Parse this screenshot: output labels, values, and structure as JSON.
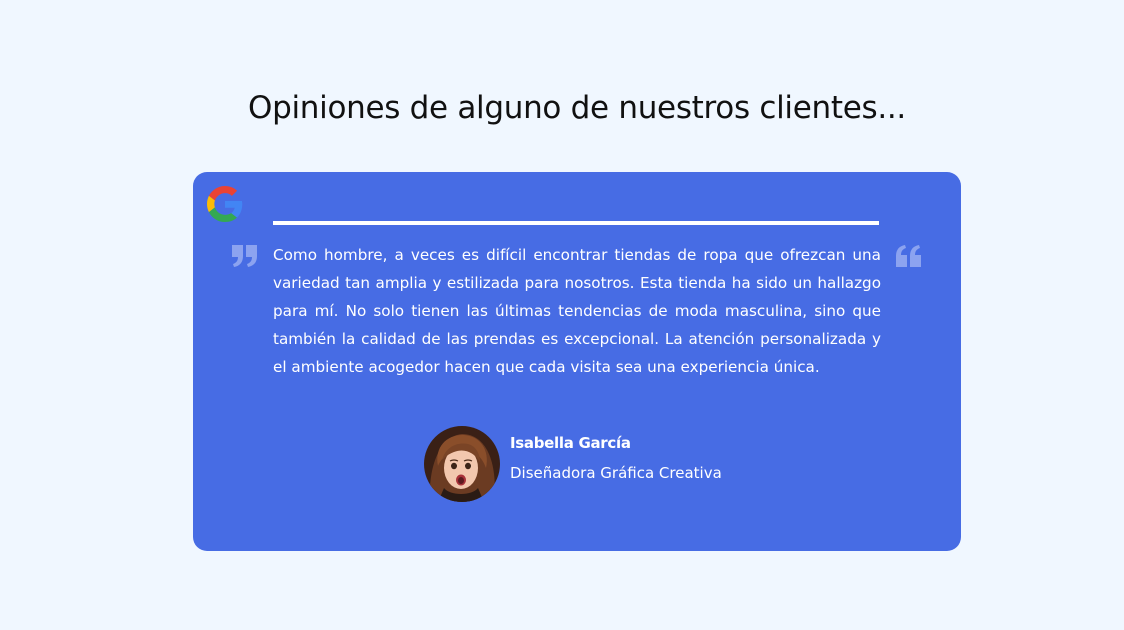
{
  "section": {
    "title": "Opiniones de alguno de nuestros clientes..."
  },
  "testimonial": {
    "source_icon": "google-icon",
    "quote_icons": [
      "quote-open-icon",
      "quote-close-icon"
    ],
    "text": "Como hombre, a veces es difícil encontrar tiendas de ropa que ofrezcan una variedad tan amplia y estilizada para nosotros. Esta tienda ha sido un hallazgo para mí. No solo tienen las últimas tendencias de moda masculina, sino que también la calidad de las prendas es excepcional. La atención personalizada y el ambiente acogedor hacen que cada visita sea una experiencia única.",
    "author": {
      "name": "Isabella García",
      "role": "Diseñadora Gráfica Creativa"
    }
  },
  "colors": {
    "page_background": "#f0f7ff",
    "card_background": "#476ce4",
    "text_on_card": "#ffffff",
    "quote_icon": "#8ca3f0"
  }
}
